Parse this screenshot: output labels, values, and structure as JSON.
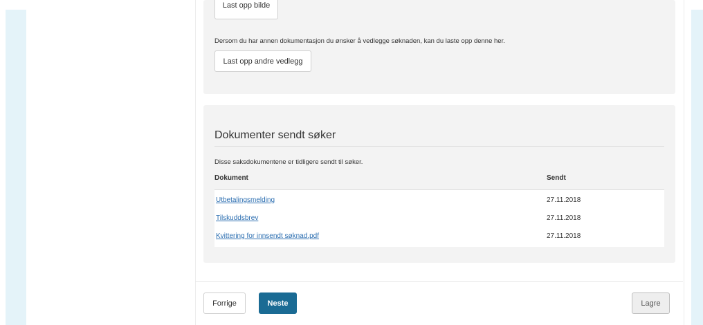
{
  "upload": {
    "cut_button_label": "Last opp bilde",
    "info_text": "Dersom du har annen dokumentasjon du ønsker å vedlegge søknaden, kan du laste opp denne her.",
    "other_attachments_button": "Last opp andre vedlegg"
  },
  "documents": {
    "title": "Dokumenter sendt søker",
    "description": "Disse saksdokumentene er tidligere sendt til søker.",
    "columns": [
      "Dokument",
      "Sendt"
    ],
    "rows": [
      {
        "name": "Utbetalingsmelding",
        "date": "27.11.2018"
      },
      {
        "name": "Tilskuddsbrev",
        "date": "27.11.2018"
      },
      {
        "name": "Kvittering for innsendt søknad.pdf",
        "date": "27.11.2018"
      }
    ]
  },
  "footer": {
    "previous_label": "Forrige",
    "next_label": "Neste",
    "save_label": "Lagre"
  },
  "colors": {
    "side_band": "#e4f3f9",
    "panel_bg": "#f3f3f3",
    "primary_button": "#1a6b94",
    "link": "#2a6db0"
  }
}
